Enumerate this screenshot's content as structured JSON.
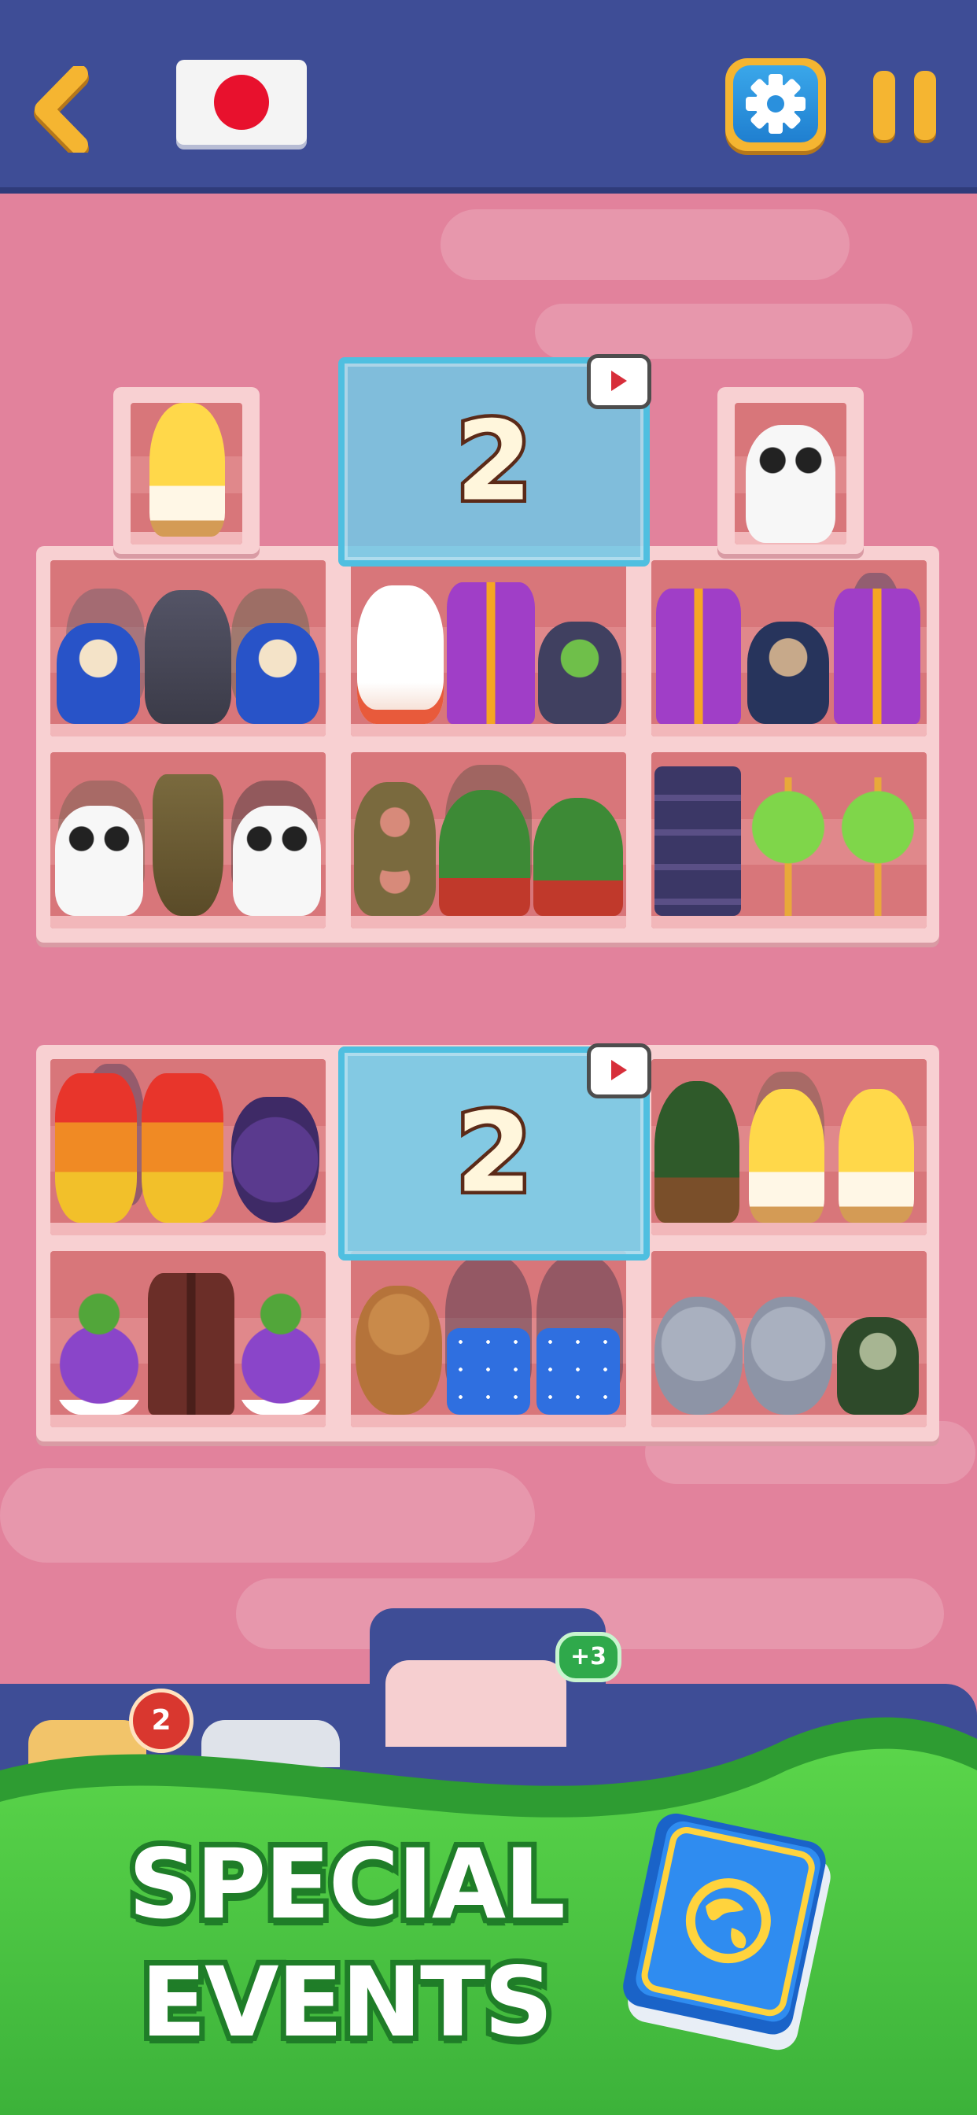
{
  "game": {
    "country_flag": "japan"
  },
  "header": {
    "back_icon": "chevron-left-icon",
    "settings_icon": "gear-icon",
    "pause_icon": "pause-icon",
    "colors": {
      "bar": "#3e4d96",
      "accent": "#f5b531",
      "settings": "#2a90dd"
    }
  },
  "board": {
    "top_cabinet": {
      "extra_shelves": [
        {
          "items": [
            "chick-popsicle"
          ]
        },
        {
          "items": [
            "panda"
          ]
        }
      ],
      "locked_slot": {
        "count": "2",
        "reward_icon": "video-ad-icon"
      },
      "rows": [
        [
          [
            "daruma-blue",
            "fox-mask-gray",
            "daruma-blue"
          ],
          [
            "fox-mask-white",
            "kimono-purple",
            "alien-ufo"
          ],
          [
            "kimono-purple",
            "daruma-navy",
            "kimono-purple"
          ]
        ],
        [
          [
            "panda",
            "trumpet",
            "panda"
          ],
          [
            "donut",
            "bonsai",
            "bonsai"
          ],
          [
            "koinobori",
            "uchiwa-fan",
            "uchiwa-fan"
          ]
        ]
      ]
    },
    "bottom_cabinet": {
      "locked_slot": {
        "count": "2",
        "reward_icon": "video-ad-icon"
      },
      "rows": [
        [
          [
            "dango-skewer",
            "dango-skewer",
            "grapes"
          ],
          [],
          [
            "topiary",
            "chick-popsicle",
            "chick-popsicle"
          ]
        ],
        [
          [
            "grapes",
            "kimono-brown",
            "grapes"
          ],
          [
            "teddy-bear",
            "dice",
            "dice"
          ],
          [
            "koala",
            "koala",
            "daruma-green"
          ]
        ]
      ]
    }
  },
  "tray": {
    "booster_count": "2",
    "extra_slots": "+3"
  },
  "promo": {
    "line1": "SPECIAL",
    "line2": "EVENTS",
    "book_icon": "globe-book-icon"
  }
}
